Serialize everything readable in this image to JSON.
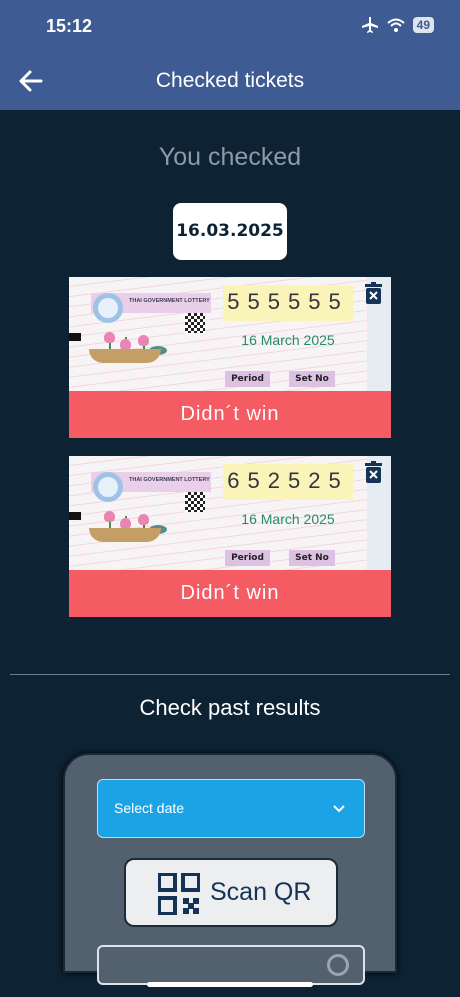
{
  "status": {
    "time": "15:12",
    "battery": "49"
  },
  "header": {
    "title": "Checked tickets"
  },
  "checked": {
    "heading": "You checked",
    "date": "16.03.2025",
    "tickets": [
      {
        "org": "THAI GOVERNMENT LOTTERY",
        "number": "555555",
        "draw_date": "16 March 2025",
        "period_label": "Period",
        "set_label": "Set No",
        "result": "Didn´t win"
      },
      {
        "org": "THAI GOVERNMENT LOTTERY",
        "number": "652525",
        "draw_date": "16 March 2025",
        "period_label": "Period",
        "set_label": "Set No",
        "result": "Didn´t win"
      }
    ]
  },
  "past": {
    "heading": "Check past results",
    "select_placeholder": "Select date",
    "scan_label": "Scan QR"
  },
  "colors": {
    "header_bg": "#3e5c93",
    "page_bg": "#0d2233",
    "lost_banner": "#f45b63",
    "select_bg": "#1ba3e6"
  }
}
